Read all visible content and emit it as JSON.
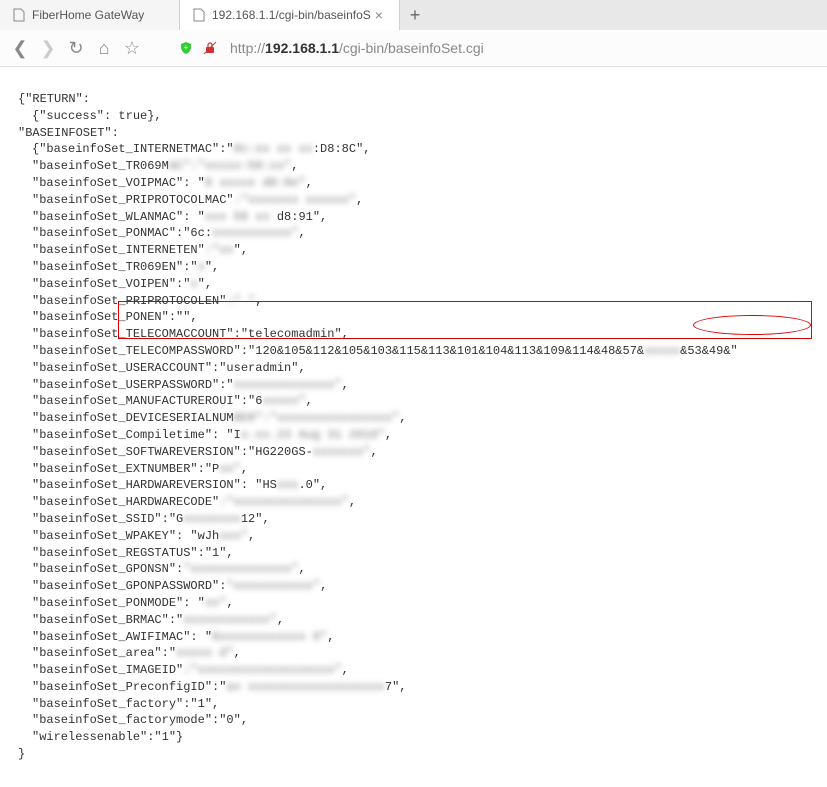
{
  "tabs": {
    "tab1": {
      "icon": "page-icon",
      "label": "FiberHome GateWay"
    },
    "tab2": {
      "icon": "page-icon",
      "label": "192.168.1.1/cgi-bin/baseinfoS"
    },
    "newTab": "+"
  },
  "nav": {
    "back": "❮",
    "forward": "❯",
    "reload": "↻",
    "home": "⌂",
    "favorite": "☆"
  },
  "url": {
    "protocol": "http://",
    "host": "192.168.1.1",
    "path": "/cgi-bin/baseinfoSet.cgi"
  },
  "json": {
    "returnKey": "{\"RETURN\":",
    "successLine": "{\"success\": true},",
    "baseinfosetKey": "\"BASEINFOSET\":",
    "lines": [
      {
        "key": "{\"baseinfoSet_INTERNETMAC\":\"",
        "blur": "0c:xx xx xx",
        "tail": ":D8:8C\","
      },
      {
        "key": "\"baseinfoSet_TR069M",
        "blur": "AC\":\"xxxxx:58:xx\"",
        "tail": ","
      },
      {
        "key": "\"baseinfoSet_VOIPMAC\": \"",
        "blur": "8 xxxxx d8:8e\"",
        "tail": ","
      },
      {
        "key": "\"baseinfoSet_PRIPROTOCOLMAC\"",
        "blur": ":\"xxxxxxx xxxxxx\"",
        "tail": ","
      },
      {
        "key": "\"baseinfoSet_WLANMAC\": \"",
        "blur": "xxx 58 xx",
        "tail": " d8:91\","
      },
      {
        "key": "\"baseinfoSet_PONMAC\":\"6c:",
        "blur": "xxxxxxxxxxx\"",
        "tail": ","
      },
      {
        "key": "\"baseinfoSet_INTERNETEN\"",
        "blur": ":\"xx",
        "tail": "\","
      },
      {
        "key": "\"baseinfoSet_TR069EN\":\"",
        "blur": "x",
        "tail": "\","
      },
      {
        "key": "\"baseinfoSet_VOIPEN\":\"",
        "blur": "x",
        "tail": "\","
      },
      {
        "key": "\"baseinfoSet_PRIPROTOCOLEN\"",
        "blur": ":\" \"",
        "tail": ","
      },
      {
        "key": "\"baseinfoSet_PONEN\":\"\",",
        "blur": "",
        "tail": ""
      },
      {
        "key": "\"baseinfoSet_TELECOMACCOUNT\":\"telecomadmin\",",
        "blur": "",
        "tail": ""
      },
      {
        "key": "\"baseinfoSet_TELECOMPASSWORD\":\"120&105&112&105&103&115&113&101&104&113&109&114&48&57&",
        "blur": "xxxxx",
        "tail": "&53&49&\""
      },
      {
        "key": "\"baseinfoSet_USERACCOUNT\":\"useradmin\",",
        "blur": "",
        "tail": ""
      },
      {
        "key": "\"baseinfoSet_USERPASSWORD\":\"",
        "blur": "xxxxxxxxxxxxxx\"",
        "tail": ","
      },
      {
        "key": "\"baseinfoSet_MANUFACTUREROUI\":\"6",
        "blur": "xxxxx\"",
        "tail": ","
      },
      {
        "key": "\"baseinfoSet_DEVICESERIALNUM",
        "blur": "BER\":\"xxxxxxxxxxxxxxxx\"",
        "tail": ","
      },
      {
        "key": "\"baseinfoSet_Compiletime\": \"I",
        "blur": "x.xx.23 Aug 31 2016\"",
        "tail": ","
      },
      {
        "key": "\"baseinfoSet_SOFTWAREVERSION\":\"HG220GS-",
        "blur": "xxxxxxx\"",
        "tail": ","
      },
      {
        "key": "\"baseinfoSet_EXTNUMBER\":\"P",
        "blur": "xx\"",
        "tail": ","
      },
      {
        "key": "\"baseinfoSet_HARDWAREVERSION\": \"HS",
        "blur": "xxx",
        "tail": ".0\","
      },
      {
        "key": "\"baseinfoSet_HARDWARECODE\"",
        "blur": ":\"xxxxxxxxxxxxxxx\"",
        "tail": ","
      },
      {
        "key": "\"baseinfoSet_SSID\":\"G",
        "blur": "xxxxxxxx",
        "tail": "12\","
      },
      {
        "key": "\"baseinfoSet_WPAKEY\": \"wJh",
        "blur": "xxx\"",
        "tail": ","
      },
      {
        "key": "\"baseinfoSet_REGSTATUS\":\"1\",",
        "blur": "",
        "tail": ""
      },
      {
        "key": "\"baseinfoSet_GPONSN\":",
        "blur": "\"xxxxxxxxxxxxxx\"",
        "tail": ","
      },
      {
        "key": "\"baseinfoSet_GPONPASSWORD\":",
        "blur": "\"xxxxxxxxxxx\"",
        "tail": ","
      },
      {
        "key": "\"baseinfoSet_PONMODE\": \"",
        "blur": "xx\"",
        "tail": ","
      },
      {
        "key": "\"baseinfoSet_BRMAC\":\"",
        "blur": "xxxxxxxxxxxx\"",
        "tail": ","
      },
      {
        "key": "\"baseinfoSet_AWIFIMAC\": \"",
        "blur": "6xxxxxxxxxxxx  0\"",
        "tail": ","
      },
      {
        "key": "\"baseinfoSet_area\":\"",
        "blur": "xxxxx d\"",
        "tail": ","
      },
      {
        "key": "\"baseinfoSet_IMAGEID\"",
        "blur": ":\"xxxxxxxxxxxxxxxxxxx\"",
        "tail": ","
      },
      {
        "key": "\"baseinfoSet_PreconfigID\":\"",
        "blur": "ax xxxxxxxxxxxxxxxxxxx",
        "tail": "7\","
      },
      {
        "key": "\"baseinfoSet_factory\":\"1\",",
        "blur": "",
        "tail": ""
      },
      {
        "key": "\"baseinfoSet_factorymode\":\"0\",",
        "blur": "",
        "tail": ""
      },
      {
        "key": "\"wirelessenable\":\"1\"}",
        "blur": "",
        "tail": ""
      }
    ],
    "close": "}"
  }
}
